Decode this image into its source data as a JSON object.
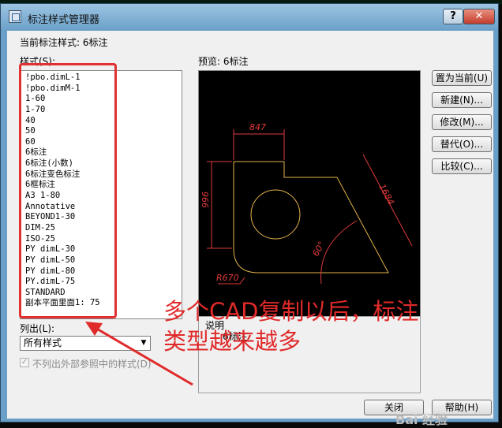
{
  "window": {
    "title": "标注样式管理器",
    "help_label": "?",
    "close_label": "✕"
  },
  "current_style_label": "当前标注样式: 6标注",
  "styles_label": "样式(S):",
  "styles": [
    "!pbo.dimL-1",
    "!pbo.dimM-1",
    "1-60",
    "1-70",
    "40",
    "50",
    "60",
    "6标注",
    "6标注(小数)",
    "6标注变色标注",
    "6框标注",
    "A3 1-80",
    "Annotative",
    "BEYOND1-30",
    "DIM-25",
    "ISO-25",
    "PY dimL-30",
    "PY dimL-50",
    "PY dimL-80",
    "PY.dimL-75",
    "STANDARD",
    "副本平面里面1: 75"
  ],
  "list_label": "列出(L):",
  "list_filter": "所有样式",
  "exclude_xref_label": "不列出外部参照中的样式(D)",
  "exclude_xref_checked": true,
  "preview_label": "预览: 6标注",
  "preview_dims": {
    "top": "847",
    "left": "996",
    "right": "1684",
    "angle": "60°",
    "radius": "R670"
  },
  "description": {
    "title": "说明",
    "text": "6标注"
  },
  "buttons": {
    "set_current": "置为当前(U)",
    "new": "新建(N)...",
    "modify": "修改(M)...",
    "override": "替代(O)...",
    "compare": "比较(C)...",
    "close": "关闭",
    "help": "帮助(H)"
  },
  "annotation": {
    "line1": "多个CAD复制以后，标注",
    "line2": "类型越来越多"
  },
  "watermark": "Bai 经验",
  "colors": {
    "annotation": "#e02a2a",
    "preview_geometry": "#e3b24a",
    "preview_dims": "#e03a3a",
    "preview_bg": "#000000"
  }
}
